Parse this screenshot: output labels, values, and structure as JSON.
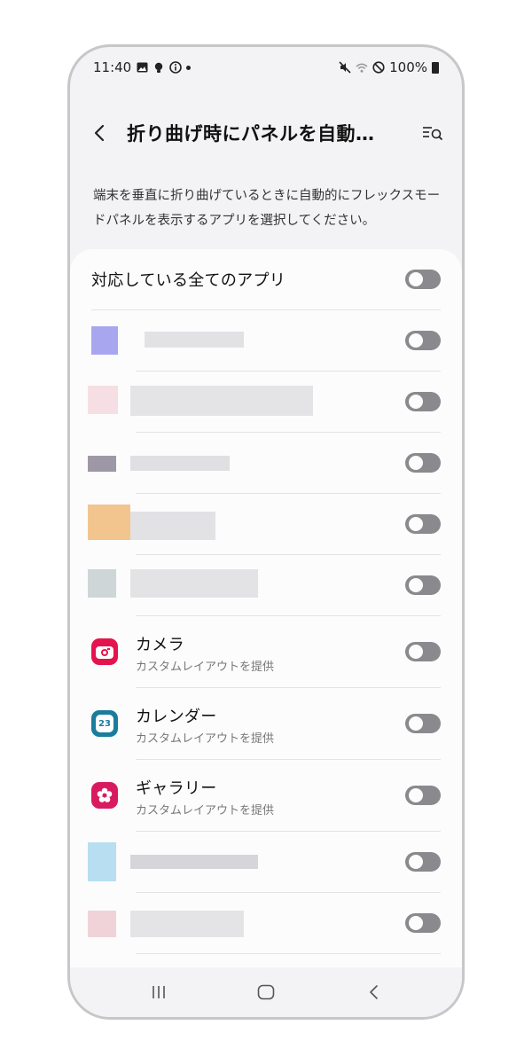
{
  "status_bar": {
    "time": "11:40",
    "battery": "100%",
    "left_icons": [
      "gallery-icon",
      "bulb-icon",
      "info-icon",
      "dot-icon"
    ],
    "right_icons": [
      "mute-icon",
      "wifi-icon",
      "dnd-icon",
      "battery-icon"
    ]
  },
  "header": {
    "title": "折り曲げ時にパネルを自動…",
    "back_icon": "chevron-left-icon",
    "search_icon": "list-search-icon"
  },
  "description": "端末を垂直に折り曲げているときに自動的にフレックスモードパネルを表示するアプリを選択してください。",
  "all_apps": {
    "label": "対応している全てのアプリ",
    "enabled": false
  },
  "apps": [
    {
      "name": "カメラ",
      "subtitle": "カスタムレイアウトを提供",
      "icon": "camera-icon",
      "color": "#e4144e",
      "enabled": false
    },
    {
      "name": "カレンダー",
      "subtitle": "カスタムレイアウトを提供",
      "icon": "calendar-icon",
      "icon_text": "23",
      "color": "#1a7d9c",
      "enabled": false
    },
    {
      "name": "ギャラリー",
      "subtitle": "カスタムレイアウトを提供",
      "icon": "gallery-flower-icon",
      "color": "#d81b60",
      "enabled": false
    }
  ],
  "navbar": {
    "icons": [
      "recent-apps-icon",
      "home-icon",
      "back-icon"
    ]
  },
  "colors": {
    "toggle_off": "#8a8a8e",
    "background": "#f3f3f5",
    "card": "#fcfcfd"
  }
}
